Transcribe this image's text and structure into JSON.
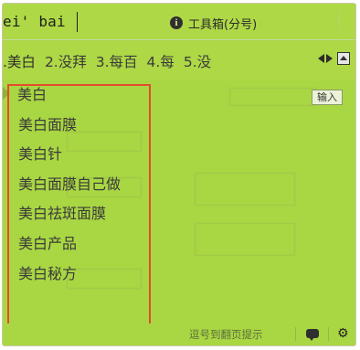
{
  "composition": {
    "pinyin": "ei' bai",
    "toolbox_label": "工具箱(分号)",
    "info_icon_glyph": "i"
  },
  "candidates": [
    {
      "label": ".美白"
    },
    {
      "label": "2.没拜"
    },
    {
      "label": "3.每百"
    },
    {
      "label": "4.每"
    },
    {
      "label": "5.没"
    }
  ],
  "pager": {
    "prev": "previous-page-icon",
    "next": "next-page-icon",
    "expand": "expand-icon"
  },
  "input_button": {
    "label": "输入"
  },
  "suggestions": [
    {
      "label": "美白"
    },
    {
      "label": "美白面膜"
    },
    {
      "label": "美白针"
    },
    {
      "label": "美白面膜自己做"
    },
    {
      "label": "美白祛斑面膜"
    },
    {
      "label": "美白产品"
    },
    {
      "label": "美白秘方"
    }
  ],
  "status_bar": {
    "text": "逗号到翻页提示"
  },
  "colors": {
    "skin_background": "#a9d743",
    "highlight_box": "#e64a2f",
    "text": "#3a3a3a"
  }
}
